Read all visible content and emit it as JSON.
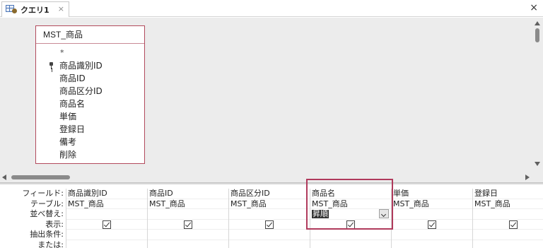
{
  "tab": {
    "title": "クエリ1",
    "close_glyph": "×"
  },
  "window": {
    "close_glyph": "×"
  },
  "table": {
    "name": "MST_商品",
    "star": "*",
    "fields": [
      "商品識別ID",
      "商品ID",
      "商品区分ID",
      "商品名",
      "単価",
      "登録日",
      "備考",
      "削除"
    ]
  },
  "grid": {
    "row_labels": [
      "フィールド:",
      "テーブル:",
      "並べ替え:",
      "表示:",
      "抽出条件:",
      "または:"
    ],
    "columns": [
      {
        "field": "商品識別ID",
        "table": "MST_商品",
        "sort": "",
        "show": true
      },
      {
        "field": "商品ID",
        "table": "MST_商品",
        "sort": "",
        "show": true
      },
      {
        "field": "商品区分ID",
        "table": "MST_商品",
        "sort": "",
        "show": true
      },
      {
        "field": "商品名",
        "table": "MST_商品",
        "sort": "昇順",
        "show": true
      },
      {
        "field": "単価",
        "table": "MST_商品",
        "sort": "",
        "show": true
      },
      {
        "field": "登録日",
        "table": "MST_商品",
        "sort": "",
        "show": true
      }
    ]
  },
  "colors": {
    "accent": "#b03a5c",
    "table_border": "#b24a5c",
    "design_bg": "#ececec"
  },
  "icons": {
    "tab": "query-design-icon",
    "key": "primary-key-icon",
    "checkbox": "checkbox-checked-icon",
    "dropdown": "chevron-down-icon"
  }
}
